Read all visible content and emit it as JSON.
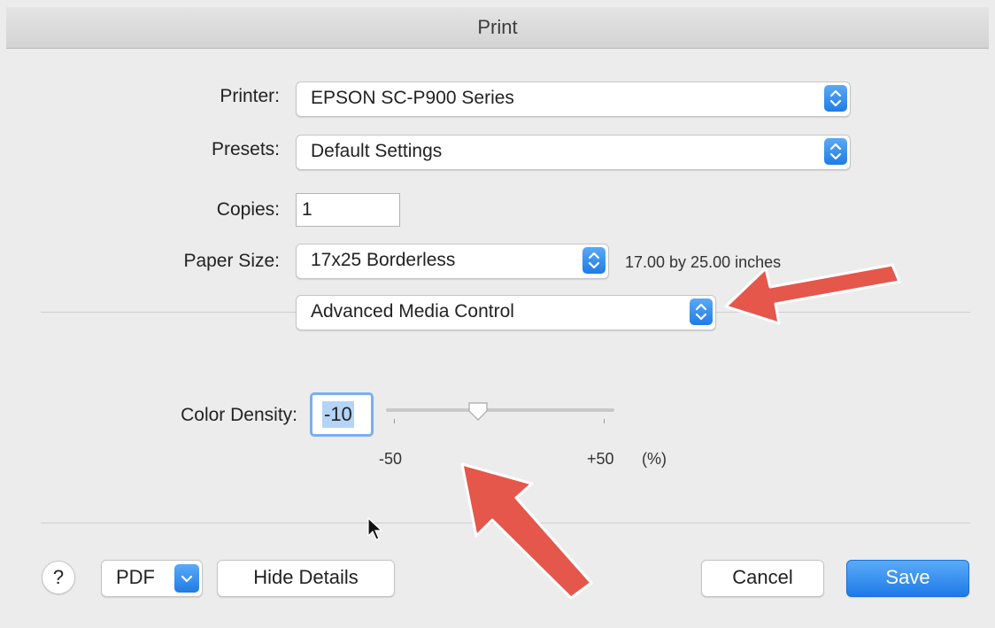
{
  "window": {
    "title": "Print"
  },
  "printer": {
    "label": "Printer:",
    "value": "EPSON SC-P900 Series"
  },
  "presets": {
    "label": "Presets:",
    "value": "Default Settings"
  },
  "copies": {
    "label": "Copies:",
    "value": "1"
  },
  "paper_size": {
    "label": "Paper Size:",
    "value": "17x25 Borderless",
    "dimensions": "17.00 by 25.00 inches"
  },
  "section_popup": {
    "value": "Advanced Media Control"
  },
  "color_density": {
    "label": "Color Density:",
    "value": "-10",
    "slider_min_label": "-50",
    "slider_max_label": "+50",
    "unit_label": "(%)",
    "slider_value": -10,
    "slider_min": -50,
    "slider_max": 50
  },
  "footer": {
    "help_label": "?",
    "pdf_label": "PDF",
    "hide_details_label": "Hide Details",
    "cancel_label": "Cancel",
    "save_label": "Save"
  },
  "colors": {
    "accent": "#1f7ce6",
    "annotation_arrow": "#e5564b",
    "window_bg": "#ececec"
  }
}
